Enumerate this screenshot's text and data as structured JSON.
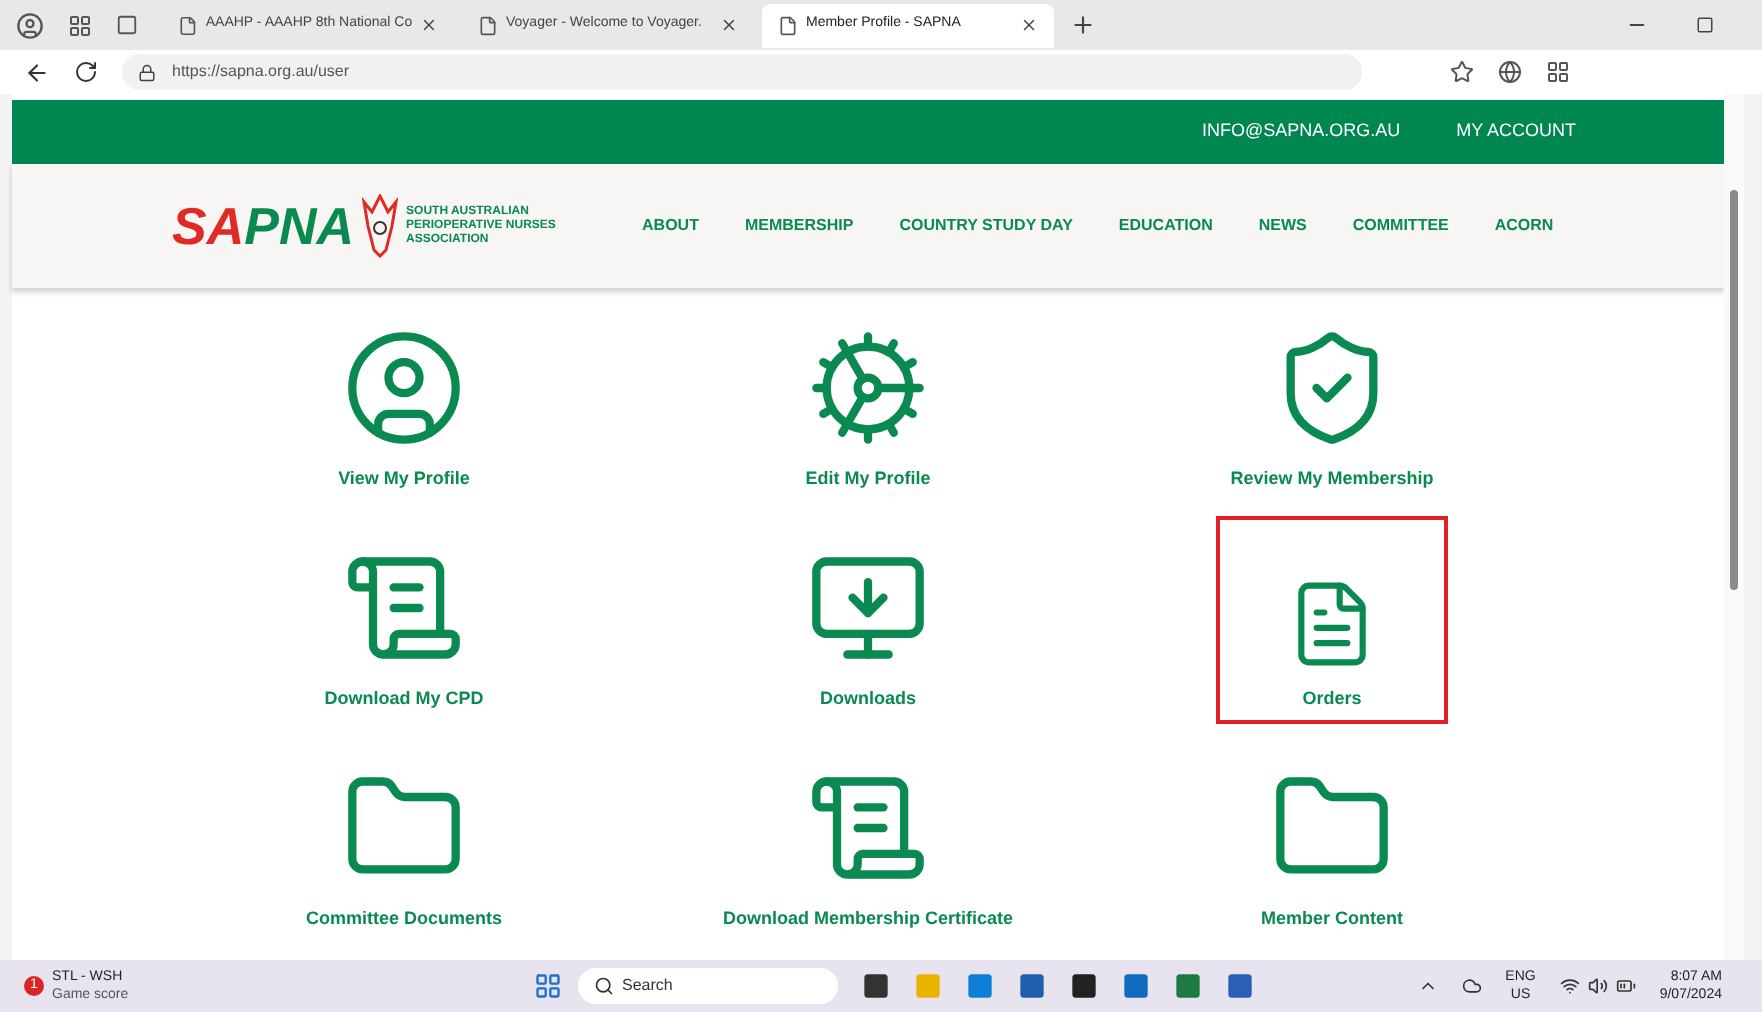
{
  "browser": {
    "tabs": [
      {
        "title": "AAAHP - AAAHP 8th National Co",
        "selected": false
      },
      {
        "title": "Voyager - Welcome to Voyager. ",
        "selected": false
      },
      {
        "title": "Member Profile - SAPNA",
        "selected": true
      }
    ],
    "address": "https://sapna.org.au/user"
  },
  "topbar": {
    "links": [
      "INFO@SAPNA.ORG.AU",
      "MY ACCOUNT"
    ]
  },
  "header": {
    "logo": "SAPNA",
    "tagline": "SOUTH AUSTRALIAN PERIOPERATIVE NURSES ASSOCIATION",
    "nav": [
      "ABOUT",
      "MEMBERSHIP",
      "COUNTRY STUDY DAY",
      "EDUCATION",
      "NEWS",
      "COMMITTEE",
      "ACORN"
    ]
  },
  "tiles": [
    {
      "kind": "user",
      "label": "View My Profile",
      "selected": false
    },
    {
      "kind": "gear",
      "label": "Edit My Profile",
      "selected": false
    },
    {
      "kind": "shield",
      "label": "Review My Membership",
      "selected": false
    },
    {
      "kind": "scroll",
      "label": "Download My CPD",
      "selected": false
    },
    {
      "kind": "monitor",
      "label": "Downloads",
      "selected": false
    },
    {
      "kind": "invoice",
      "label": "Orders",
      "selected": true
    },
    {
      "kind": "folder",
      "label": "Committee Documents",
      "selected": false
    },
    {
      "kind": "scroll",
      "label": "Download Membership Certificate",
      "selected": false
    },
    {
      "kind": "folder",
      "label": "Member Content",
      "selected": false
    }
  ],
  "taskbar": {
    "badge": "1",
    "widget_title": "STL - WSH",
    "widget_sub": "Game score",
    "search": "Search",
    "lang": "ENG",
    "region": "US",
    "time": "8:07 AM",
    "date": "9/07/2024"
  }
}
